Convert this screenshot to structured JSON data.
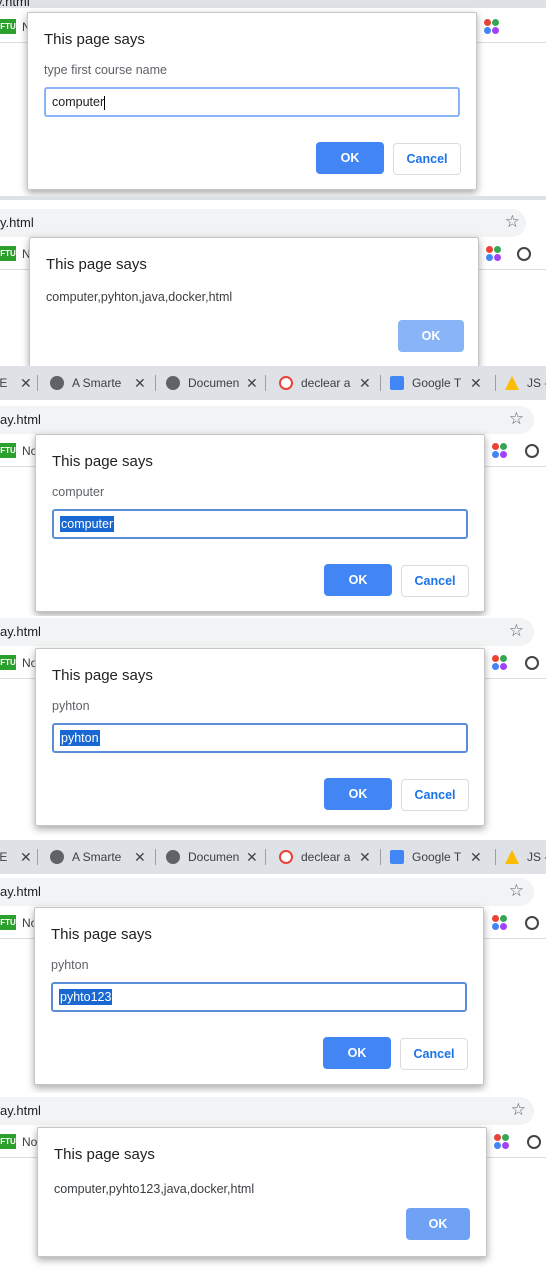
{
  "common": {
    "dialog_title": "This page says",
    "ok_label": "OK",
    "cancel_label": "Cancel",
    "url_fragment": "y.html",
    "url_fragment_alt": "ay.html",
    "bookmark_label": "No",
    "favicon_text": "FTU"
  },
  "tabs": [
    {
      "label": "IE"
    },
    {
      "label": "A Smarte"
    },
    {
      "label": "Documen"
    },
    {
      "label": "declear a"
    },
    {
      "label": "Google T"
    },
    {
      "label": "JS -"
    }
  ],
  "frames": [
    {
      "message": "type first course name",
      "input_value": "computer"
    },
    {
      "message": "computer,pyhton,java,docker,html"
    },
    {
      "message": "computer",
      "input_value": "computer"
    },
    {
      "message": "pyhton",
      "input_value": "pyhton"
    },
    {
      "message": "pyhton",
      "input_value": "pyhto123"
    },
    {
      "message": "computer,pyhto123,java,docker,html"
    }
  ],
  "colors": {
    "accent": "#4285f4",
    "accent_dim": "#8ab4f8",
    "selection": "#1967d2",
    "tabbar": "#dee1e6"
  }
}
